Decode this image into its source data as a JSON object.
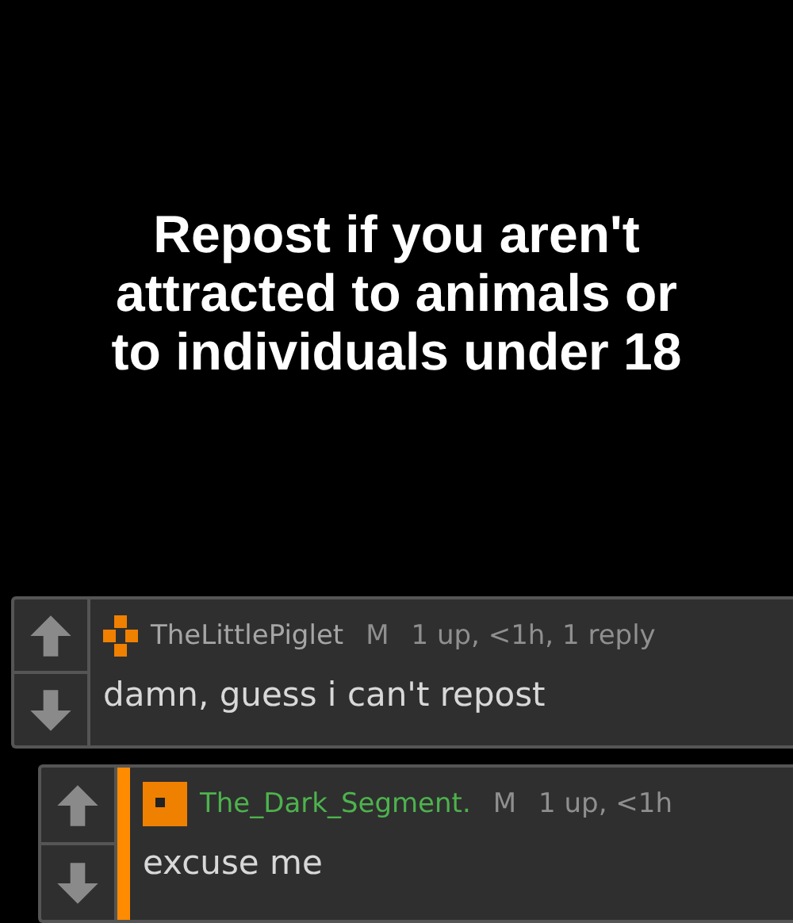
{
  "meme_text": "Repost if you aren't attracted to animals or to individuals under 18",
  "comments": [
    {
      "username": "TheLittlePiglet",
      "color": "#a6a6a6",
      "gender": "M",
      "meta": "1 up, <1h, 1 reply",
      "text": "damn, guess i can't repost",
      "highlighted": false,
      "children": [
        {
          "username": "The_Dark_Segment.",
          "color": "#4db34d",
          "gender": "M",
          "meta": "1 up, <1h",
          "text": "excuse me",
          "highlighted": true
        }
      ]
    }
  ]
}
